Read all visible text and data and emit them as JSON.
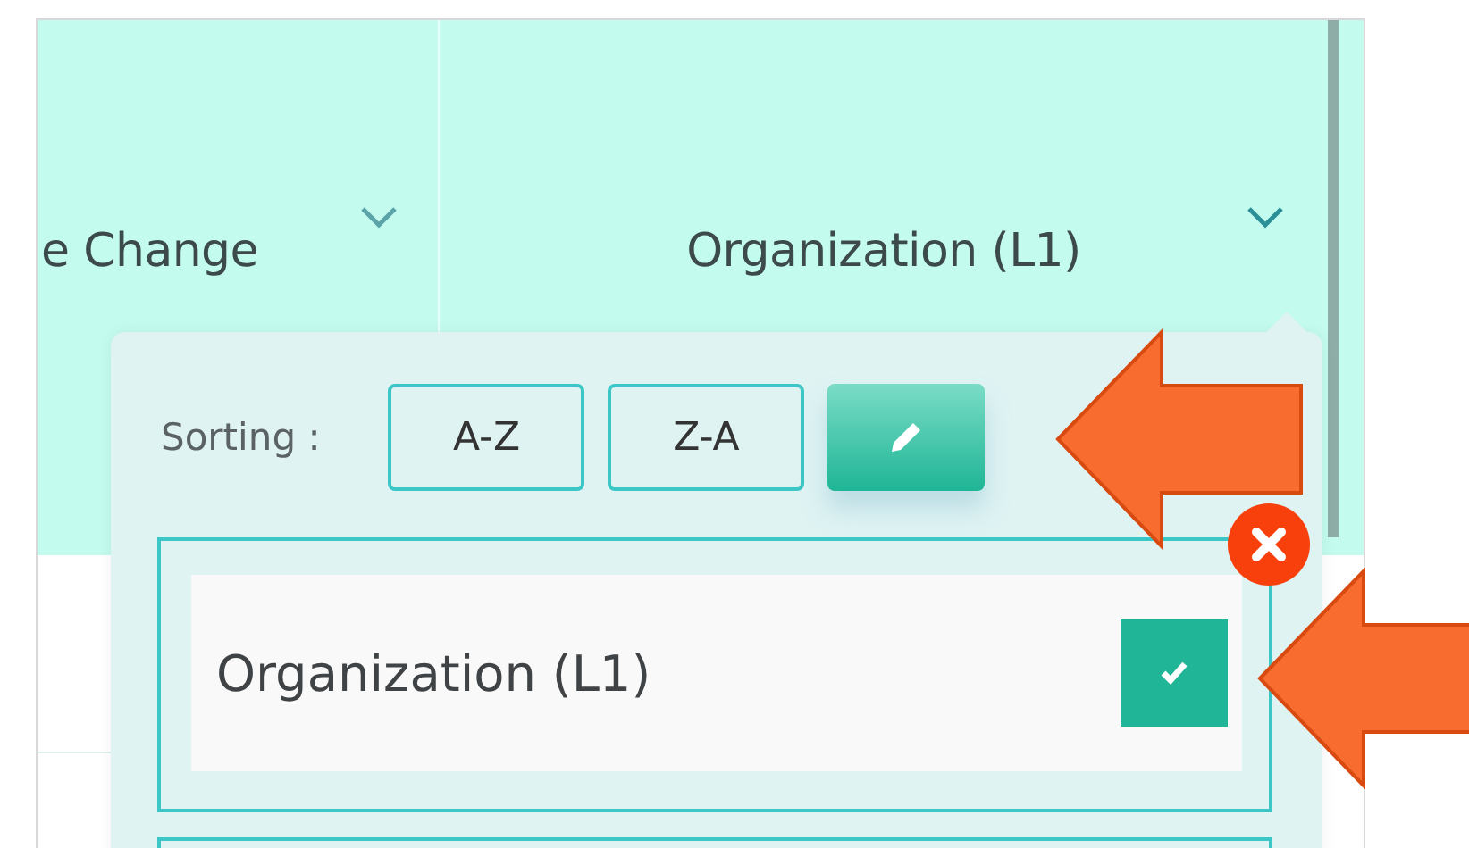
{
  "columns": [
    {
      "label": "e Change",
      "sort_open": false
    },
    {
      "label": "Organization (L1)",
      "sort_open": true
    }
  ],
  "sort_popup": {
    "label": "Sorting :",
    "buttons": [
      {
        "kind": "text",
        "label": "A-Z",
        "selected": false
      },
      {
        "kind": "text",
        "label": "Z-A",
        "selected": false
      },
      {
        "kind": "edit",
        "selected": true
      }
    ],
    "items": [
      {
        "label": "Organization (L1)",
        "checked": true,
        "removable": true
      }
    ]
  },
  "annotations": [
    {
      "kind": "arrow"
    },
    {
      "kind": "arrow"
    }
  ]
}
